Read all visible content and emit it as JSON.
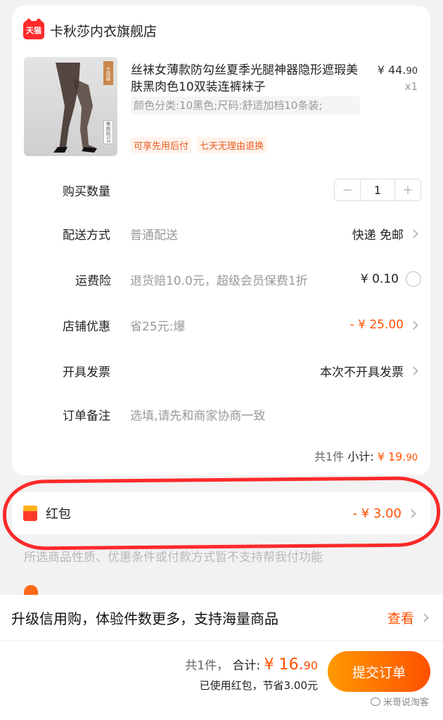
{
  "store": {
    "badge": "天猫",
    "name": "卡秋莎内衣旗舰店"
  },
  "product": {
    "image_tag": "十双装",
    "image_tag2": "黑肉色10",
    "title": "丝袜女薄款防勾丝夏季光腿神器隐形遮瑕美肤黑肉色10双装连裤袜子",
    "price_main": "¥ 44.",
    "price_cents": "90",
    "qty": "x1",
    "sku": "颜色分类:10黑色;尺码:舒适加档10条装;",
    "tags": [
      "可享先用后付",
      "七天无理由退换"
    ]
  },
  "rows": {
    "quantity": {
      "label": "购买数量",
      "minus": "−",
      "value": "1",
      "plus": "+"
    },
    "shipping": {
      "label": "配送方式",
      "sub": "普通配送",
      "value": "快递 免邮"
    },
    "insurance": {
      "label": "运费险",
      "sub": "退货赔10.0元，超级会员保费1折",
      "value": "¥ 0.10"
    },
    "discount": {
      "label": "店铺优惠",
      "sub": "省25元:爆",
      "value": "- ¥ 25.00"
    },
    "invoice": {
      "label": "开具发票",
      "value": "本次不开具发票"
    },
    "note": {
      "label": "订单备注",
      "placeholder": "选填,请先和商家协商一致"
    }
  },
  "subtotal": {
    "count": "共1件",
    "label": "小计:",
    "amount": "¥ 19.",
    "cents": "90"
  },
  "hongbao": {
    "label": "红包",
    "value": "- ¥ 3.00"
  },
  "notice": "所选商品性质、优惠条件或付款方式暂不支持帮我付功能",
  "upgrade": {
    "text": "升级信用购，体验件数更多，支持海量商品",
    "link": "查看"
  },
  "bottom": {
    "count": "共1件，",
    "total_label": "合计:",
    "total_amount": "¥ 16.",
    "total_cents": "90",
    "saved": "已使用红包，节省3.00元",
    "submit": "提交订单",
    "watermark": "米哥说淘客"
  },
  "colors": {
    "accent": "#ff5000",
    "tmall_red": "#ff2b2b",
    "annotation_red": "#ff2a2a"
  }
}
